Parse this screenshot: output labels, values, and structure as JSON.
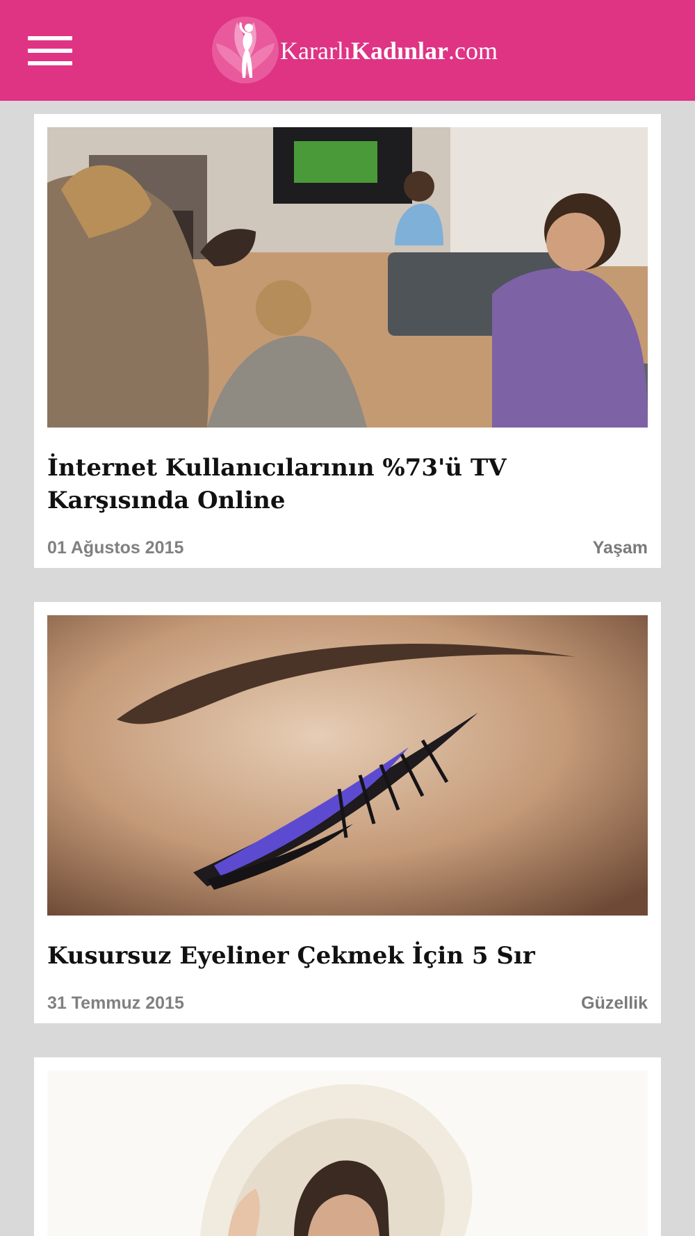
{
  "header": {
    "brand_prefix": "Kararlı",
    "brand_bold": "Kadınlar",
    "brand_suffix": ".com",
    "menu_icon": "hamburger-menu-icon",
    "colors": {
      "bar": "#df3384",
      "text": "#ffffff"
    }
  },
  "articles": [
    {
      "title": "İnternet Kullanıcılarının %73'ü TV Karşısında Online",
      "date": "01 Ağustos 2015",
      "category": "Yaşam",
      "image": "family-watching-tv-photo"
    },
    {
      "title": "Kusursuz Eyeliner Çekmek İçin 5 Sır",
      "date": "31 Temmuz 2015",
      "category": "Güzellik",
      "image": "purple-eyeliner-eye-photo"
    },
    {
      "title": "",
      "date": "",
      "category": "",
      "image": "woman-covering-ears-with-pillow-photo"
    }
  ]
}
